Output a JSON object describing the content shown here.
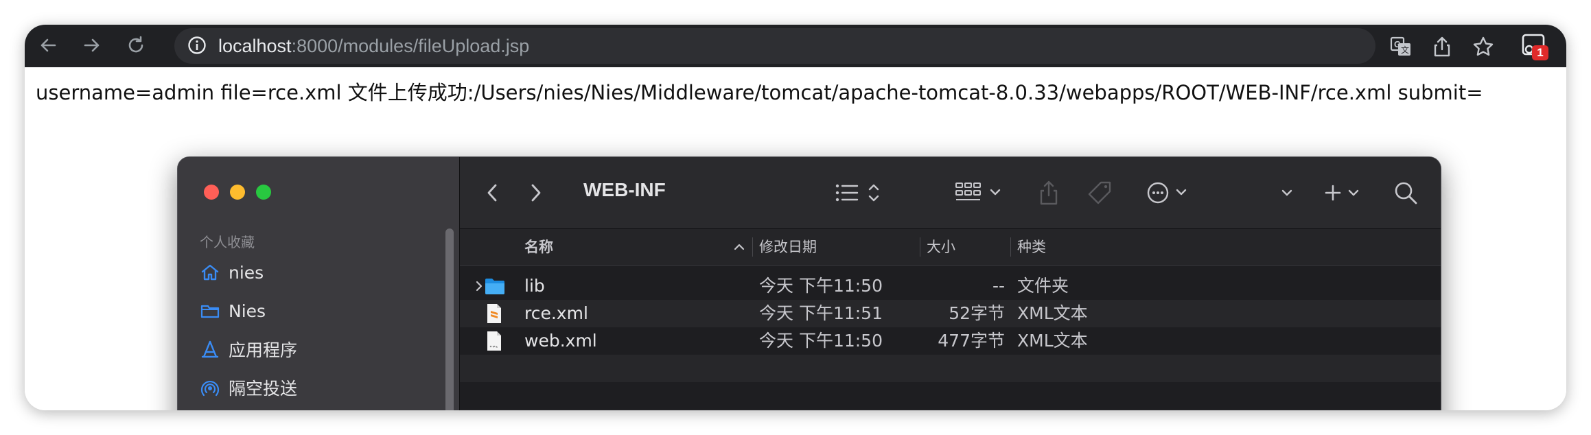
{
  "browser": {
    "url_host": "localhost",
    "url_rest": ":8000/modules/fileUpload.jsp",
    "extension_badge": "1",
    "icons": [
      "back-arrow-icon",
      "forward-arrow-icon",
      "reload-icon",
      "info-icon",
      "translate-icon",
      "share-icon",
      "star-icon",
      "extension-icon"
    ]
  },
  "page": {
    "response_text": "username=admin file=rce.xml 文件上传成功:/Users/nies/Nies/Middleware/tomcat/apache-tomcat-8.0.33/webapps/ROOT/WEB-INF/rce.xml submit="
  },
  "finder": {
    "title": "WEB-INF",
    "sidebar": {
      "heading": "个人收藏",
      "items": [
        {
          "label": "nies",
          "icon": "home-icon"
        },
        {
          "label": "Nies",
          "icon": "folder-icon"
        },
        {
          "label": "应用程序",
          "icon": "applications-icon"
        },
        {
          "label": "隔空投送",
          "icon": "airdrop-icon"
        }
      ]
    },
    "columns": {
      "name": "名称",
      "modified": "修改日期",
      "size": "大小",
      "kind": "种类"
    },
    "files": [
      {
        "name": "lib",
        "modified": "今天 下午11:50",
        "size": "--",
        "kind": "文件夹",
        "icon": "folder-icon",
        "expandable": true
      },
      {
        "name": "rce.xml",
        "modified": "今天 下午11:51",
        "size": "52字节",
        "kind": "XML文本",
        "icon": "sublime-file-icon",
        "expandable": false
      },
      {
        "name": "web.xml",
        "modified": "今天 下午11:50",
        "size": "477字节",
        "kind": "XML文本",
        "icon": "xml-file-icon",
        "expandable": false
      }
    ],
    "colors": {
      "accent": "#3a8cf5",
      "traffic_red": "#ff5f57",
      "traffic_yellow": "#febc2e",
      "traffic_green": "#28c840"
    }
  }
}
